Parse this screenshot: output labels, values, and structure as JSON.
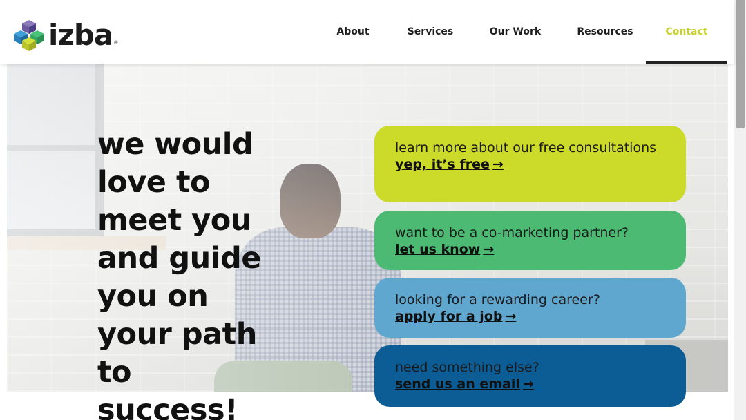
{
  "header": {
    "logo": {
      "text": "izba",
      "reg": "®",
      "icon": "cube-stack-logo-icon"
    },
    "nav": [
      {
        "label": "About"
      },
      {
        "label": "Services"
      },
      {
        "label": "Our Work"
      },
      {
        "label": "Resources"
      },
      {
        "label": "Contact",
        "active": true
      }
    ]
  },
  "hero": {
    "headline": "we would love to meet you and guide you on your path to success!"
  },
  "cards": [
    {
      "text": "learn more about our free consultations",
      "link": "yep, it’s free",
      "arrow": "→",
      "color": "#ccda29"
    },
    {
      "text": "want to be a co-marketing partner?",
      "link": "let us know",
      "arrow": "→",
      "color": "#4dba74"
    },
    {
      "text": "looking for a rewarding career?",
      "link": "apply for a job",
      "arrow": "→",
      "color": "#60a7cf"
    },
    {
      "text": "need something else?",
      "link": "send us an email",
      "arrow": "→",
      "color": "#0c5d96"
    }
  ],
  "colors": {
    "accent_contact": "#c9d22b",
    "text_dark": "#111111"
  }
}
